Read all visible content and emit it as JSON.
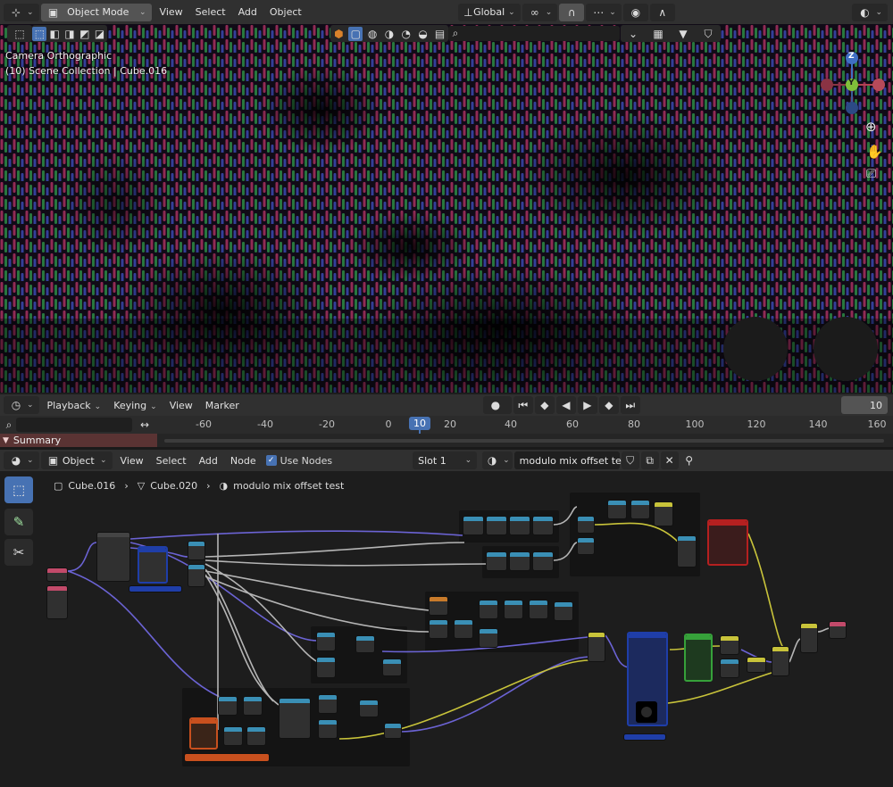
{
  "viewport_header": {
    "mode": "Object Mode",
    "menus": [
      "View",
      "Select",
      "Add",
      "Object"
    ],
    "transform_orientation": "Global"
  },
  "viewport": {
    "camera_label": "Camera Orthographic",
    "collection_label": "(10) Scene Collection | Cube.016",
    "gizmo_axes": {
      "z": "Z",
      "y": "Y"
    },
    "nav_icons": [
      "zoom-icon",
      "hand-icon",
      "camera-icon"
    ]
  },
  "timeline": {
    "menus": [
      "Playback",
      "Keying",
      "View",
      "Marker"
    ],
    "current_frame": "10",
    "ruler_ticks": [
      "-60",
      "-40",
      "-20",
      "0",
      "10",
      "20",
      "40",
      "60",
      "80",
      "100",
      "120",
      "140",
      "160"
    ],
    "summary_label": "Summary"
  },
  "node_header": {
    "type": "Object",
    "menus": [
      "View",
      "Select",
      "Add",
      "Node"
    ],
    "use_nodes_label": "Use Nodes",
    "slot": "Slot 1",
    "material_name": "modulo mix offset test"
  },
  "breadcrumb": {
    "object": "Cube.016",
    "mesh": "Cube.020",
    "material": "modulo mix offset test"
  },
  "colors": {
    "accent": "#4772b3",
    "header": "#303030",
    "panel": "#1d1d1d",
    "wire_gray": "#b5b5b5",
    "wire_purple": "#6b63d4",
    "wire_yellow": "#c8c33a",
    "node_red": "#b52020",
    "node_blue": "#1f3ea8",
    "node_green": "#36a13a",
    "node_orange": "#c8501e"
  }
}
